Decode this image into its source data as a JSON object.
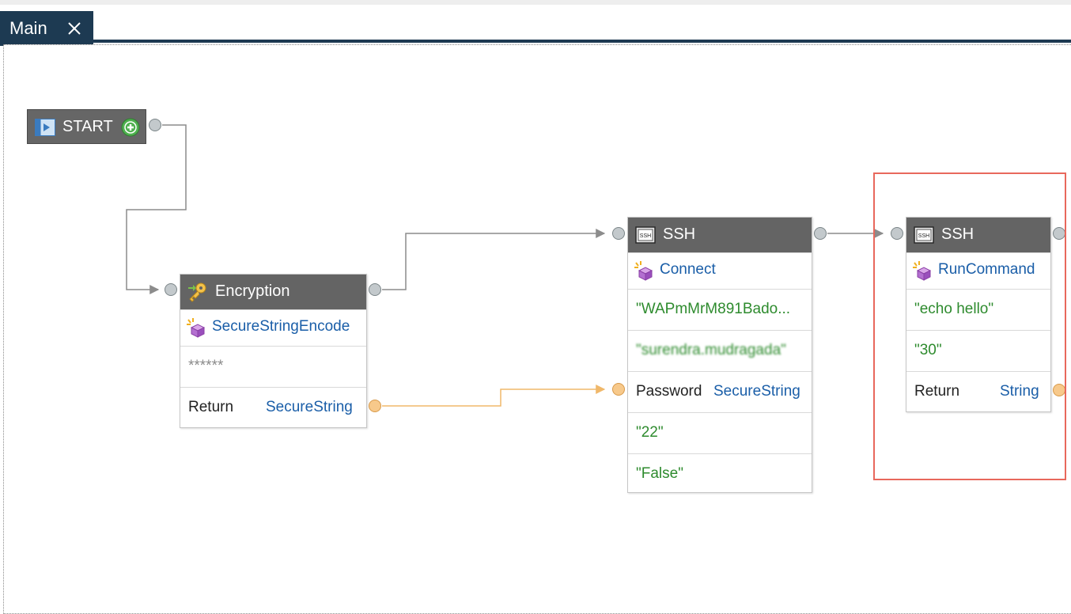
{
  "tabs": [
    {
      "label": "Main",
      "close_icon": "close-icon"
    }
  ],
  "start": {
    "label": "START",
    "icon": "start-icon",
    "add_icon": "add-circle-icon"
  },
  "nodes": {
    "encryption": {
      "title": "Encryption",
      "icon": "encryption-key-icon",
      "method": "SecureStringEncode",
      "method_icon": "method-icon",
      "input": "******",
      "return_label": "Return",
      "return_type": "SecureString"
    },
    "ssh_connect": {
      "title": "SSH",
      "icon": "ssh-icon",
      "method": "Connect",
      "method_icon": "method-icon",
      "host": "\"WAPmMrM891Bado...",
      "username": "\"surendra.mudragada\"",
      "password_label": "Password",
      "password_type": "SecureString",
      "port": "\"22\"",
      "flag": "\"False\""
    },
    "ssh_run": {
      "title": "SSH",
      "icon": "ssh-icon",
      "method": "RunCommand",
      "method_icon": "method-icon",
      "command": "\"echo hello\"",
      "timeout": "\"30\"",
      "return_label": "Return",
      "return_type": "String"
    }
  },
  "colors": {
    "header": "#646464",
    "tab": "#1d3a52",
    "value_text": "#2e8b2e",
    "type_text": "#1a5ea8",
    "highlight": "#e8685c",
    "flow_wire": "#8c8c8c",
    "data_wire": "#f0b86a"
  }
}
